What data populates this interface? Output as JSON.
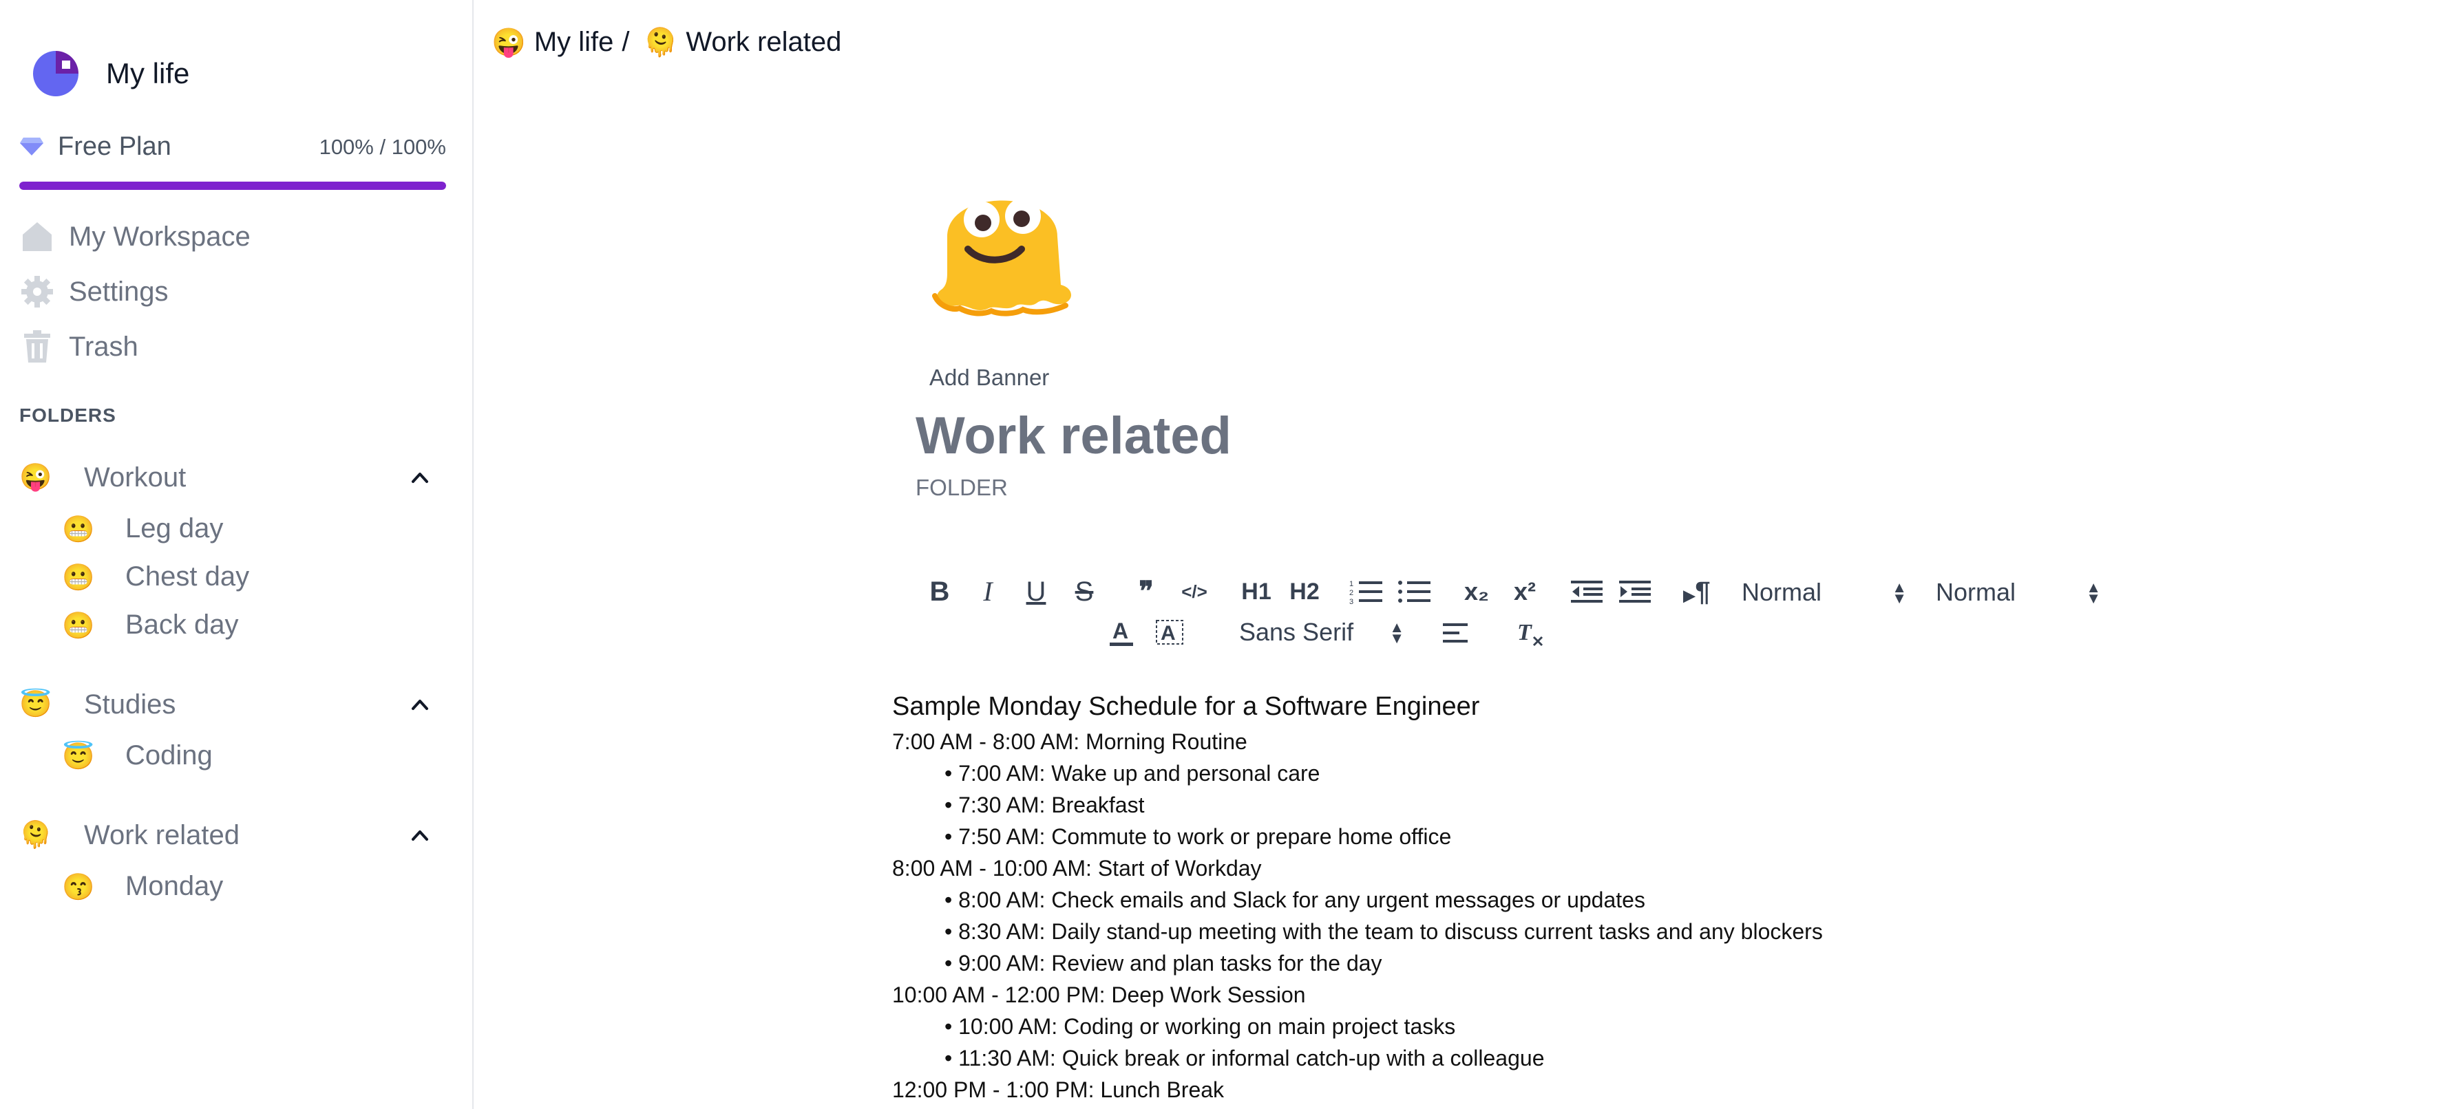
{
  "workspace": {
    "title": "My life"
  },
  "plan": {
    "name": "Free Plan",
    "usage_text": "100% / 100%",
    "usage_fraction": 1.0
  },
  "nav": {
    "workspace_label": "My Workspace",
    "settings_label": "Settings",
    "trash_label": "Trash"
  },
  "folders_heading": "FOLDERS",
  "folders": [
    {
      "emoji": "😜",
      "label": "Workout",
      "files": [
        {
          "emoji": "😬",
          "label": "Leg day"
        },
        {
          "emoji": "😬",
          "label": "Chest day"
        },
        {
          "emoji": "😬",
          "label": "Back day"
        }
      ]
    },
    {
      "emoji": "😇",
      "label": "Studies",
      "files": [
        {
          "emoji": "😇",
          "label": "Coding"
        }
      ]
    },
    {
      "emoji": "🫠",
      "label": "Work related",
      "files": [
        {
          "emoji": "😙",
          "label": "Monday"
        }
      ]
    }
  ],
  "breadcrumb": {
    "workspace_emoji": "😜",
    "workspace_label": "My life",
    "separator": "/",
    "folder_emoji": "🫠",
    "folder_label": "Work related"
  },
  "document": {
    "add_banner_label": "Add Banner",
    "title": "Work related",
    "type_label": "FOLDER"
  },
  "toolbar": {
    "bold": "B",
    "italic": "I",
    "underline": "U",
    "strike": "S",
    "quote": "❞",
    "code": "</>",
    "h1": "H1",
    "h2": "H2",
    "subscript": "x₂",
    "superscript": "x²",
    "direction": "¶",
    "header_select_value": "Normal",
    "size_select_value": "Normal",
    "font_select_value": "Sans Serif"
  },
  "editor": {
    "heading": "Sample Monday Schedule for a Software Engineer",
    "lines": [
      {
        "type": "line",
        "text": "7:00 AM - 8:00 AM: Morning Routine"
      },
      {
        "type": "bullet",
        "text": "• 7:00 AM: Wake up and personal care"
      },
      {
        "type": "bullet",
        "text": "• 7:30 AM: Breakfast"
      },
      {
        "type": "bullet",
        "text": "• 7:50 AM: Commute to work or prepare home office"
      },
      {
        "type": "line",
        "text": "8:00 AM - 10:00 AM: Start of Workday"
      },
      {
        "type": "bullet",
        "text": "• 8:00 AM: Check emails and Slack for any urgent messages or updates"
      },
      {
        "type": "bullet",
        "text": "• 8:30 AM: Daily stand-up meeting with the team to discuss current tasks and any blockers"
      },
      {
        "type": "bullet",
        "text": "• 9:00 AM: Review and plan tasks for the day"
      },
      {
        "type": "line",
        "text": "10:00 AM - 12:00 PM: Deep Work Session"
      },
      {
        "type": "bullet",
        "text": "• 10:00 AM: Coding or working on main project tasks"
      },
      {
        "type": "bullet",
        "text": "• 11:30 AM: Quick break or informal catch-up with a colleague"
      },
      {
        "type": "line",
        "text": "12:00 PM - 1:00 PM: Lunch Break"
      }
    ]
  },
  "colors": {
    "accent": "#7e22ce",
    "logo_blue": "#6366f1"
  }
}
